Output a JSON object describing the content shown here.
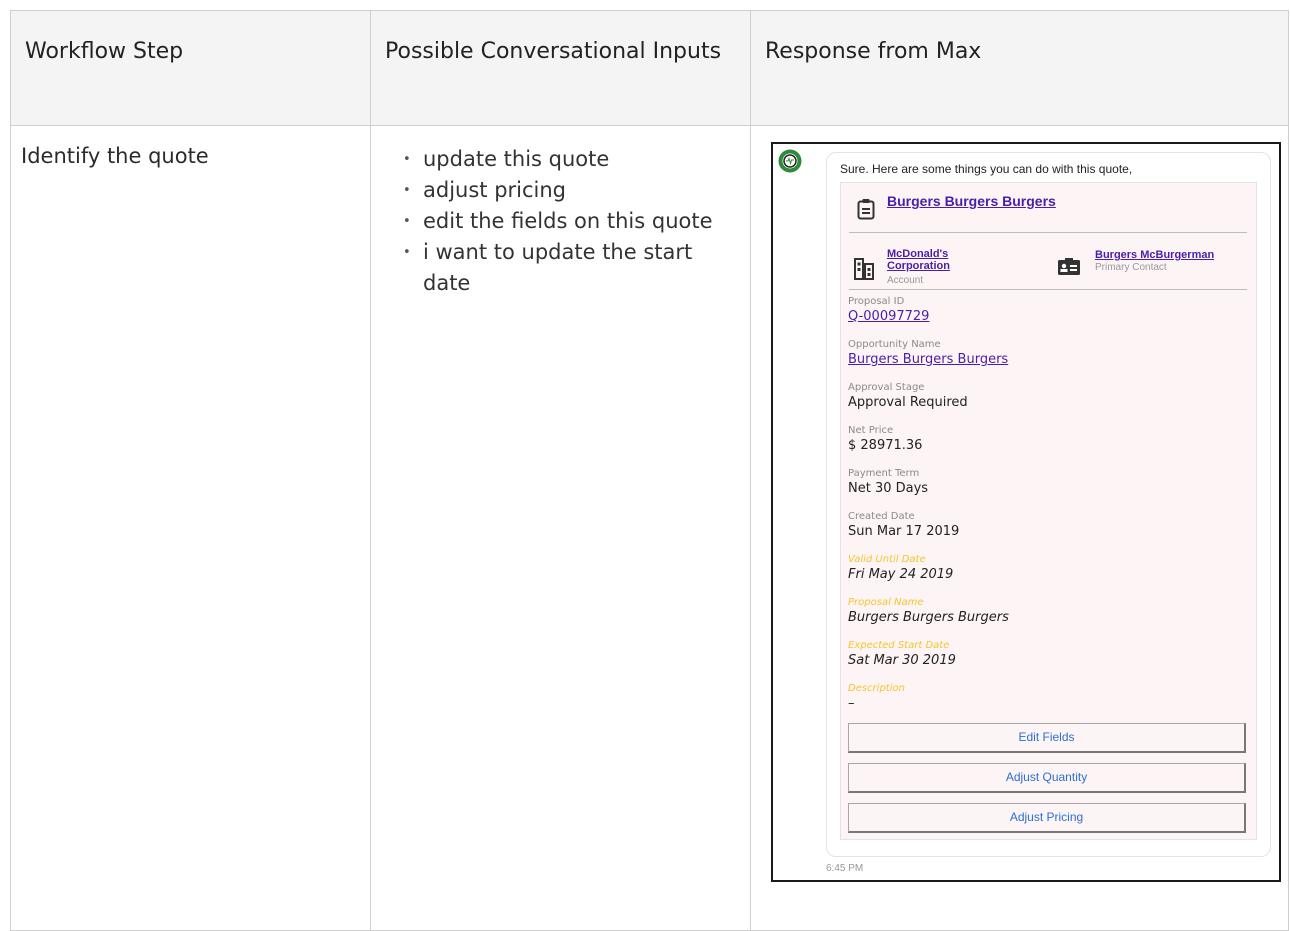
{
  "table": {
    "headers": [
      "Workflow Step",
      "Possible Conversational Inputs",
      "Response from Max"
    ],
    "rows": [
      {
        "workflow_step": "Identify the quote",
        "inputs": [
          "update this quote",
          "adjust pricing",
          "edit the fields on this quote",
          "i want to update the start date"
        ]
      }
    ]
  },
  "chat": {
    "greeting": "Sure. Here are some things you can do with this quote,",
    "timestamp": "6:45 PM",
    "card": {
      "title": "Burgers Burgers Burgers",
      "account": {
        "name": "McDonald's Corporation",
        "label": "Account"
      },
      "contact": {
        "name": "Burgers McBurgerman",
        "label": "Primary Contact"
      },
      "fields": [
        {
          "label": "Proposal ID",
          "value": "Q-00097729"
        },
        {
          "label": "Opportunity Name",
          "value": "Burgers Burgers Burgers"
        },
        {
          "label": "Approval Stage",
          "value": "Approval Required"
        },
        {
          "label": "Net Price",
          "value": "$ 28971.36"
        },
        {
          "label": "Payment Term",
          "value": "Net 30 Days"
        },
        {
          "label": "Created Date",
          "value": "Sun Mar 17 2019"
        },
        {
          "label": "Valid Until Date",
          "value": "Fri May 24 2019"
        },
        {
          "label": "Proposal Name",
          "value": "Burgers Burgers Burgers"
        },
        {
          "label": "Expected Start Date",
          "value": "Sat Mar 30 2019"
        },
        {
          "label": "Description",
          "value": "–"
        }
      ],
      "buttons": [
        "Edit Fields",
        "Adjust Quantity",
        "Adjust Pricing"
      ]
    }
  },
  "colors": {
    "link": "#4a1ea8",
    "highlight": "#f6c42d",
    "button_text": "#2a6ed6",
    "card_bg": "#fdf5f5"
  },
  "icons": [
    "bot-avatar-icon",
    "clipboard-icon",
    "building-icon",
    "contact-card-icon"
  ]
}
